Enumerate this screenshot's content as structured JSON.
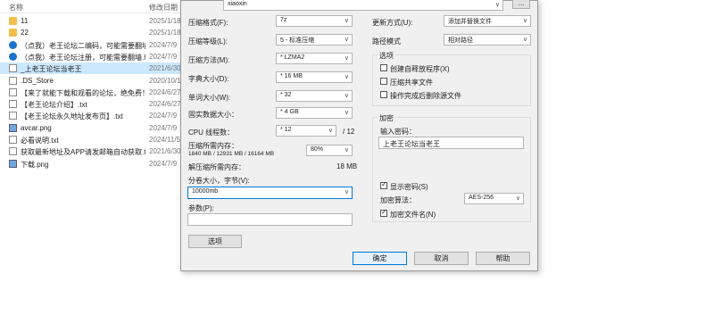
{
  "explorer": {
    "col_name": "名称",
    "col_date": "修改日期",
    "rows": [
      {
        "name": "11",
        "date": "2025/1/18",
        "icon": "folder-icon"
      },
      {
        "name": "22",
        "date": "2025/1/18",
        "icon": "folder-icon"
      },
      {
        "name": "（点我）老王论坛二编码，可能需要翻墙...",
        "date": "2024/7/9",
        "icon": "edge-icon"
      },
      {
        "name": "（点我）老王论坛注册，可能需要翻墙.h...",
        "date": "2024/7/9",
        "icon": "edge-icon"
      },
      {
        "name": "_上老王论坛当老王",
        "date": "2021/6/30",
        "icon": "file-icon"
      },
      {
        "name": ".DS_Store",
        "date": "2020/10/1",
        "icon": "file-icon"
      },
      {
        "name": "【来了就能下载和观看的论坛，绝免费！...",
        "date": "2024/6/27",
        "icon": "text-file-icon"
      },
      {
        "name": "【老王论坛介绍】.txt",
        "date": "2024/6/27",
        "icon": "text-file-icon"
      },
      {
        "name": "【老王论坛永久地址发布页】.txt",
        "date": "2024/7/9",
        "icon": "text-file-icon"
      },
      {
        "name": "avcar.png",
        "date": "2024/7/9",
        "icon": "image-icon"
      },
      {
        "name": "必看说明.txt",
        "date": "2024/11/5",
        "icon": "text-file-icon"
      },
      {
        "name": "获取最新地址及APP请发邮箱自动获取.txt",
        "date": "2021/6/30",
        "icon": "text-file-icon"
      },
      {
        "name": "下载.png",
        "date": "2024/7/9",
        "icon": "image-icon"
      }
    ],
    "selected_index": 4
  },
  "dialog": {
    "archive_name": "xiaoxin",
    "format_label": "压缩格式(F):",
    "format_value": "7z",
    "level_label": "压缩等级(L):",
    "level_value": "5 - 标准压缩",
    "method_label": "压缩方法(M):",
    "method_value": "* LZMA2",
    "dict_label": "字典大小(D):",
    "dict_value": "* 16 MB",
    "word_label": "单词大小(W):",
    "word_value": "* 32",
    "solid_label": "固实数据大小：",
    "solid_value": "* 4 GB",
    "cpu_label": "CPU 线程数：",
    "cpu_value": "* 12",
    "cpu_total": "/ 12",
    "mem_label": "压缩所需内存：",
    "mem_detail": "1840 MB / 12931 MB / 16164 MB",
    "mem_pct": "80%",
    "decomp_label": "解压缩所需内存：",
    "decomp_value": "18 MB",
    "split_label": "分卷大小，字节(V):",
    "split_value": "10000mb",
    "params_label": "参数(P):",
    "params_value": "",
    "options_button": "选项",
    "update_label": "更新方式(U):",
    "update_value": "添加并替换文件",
    "path_label": "路径模式",
    "path_value": "相对路径",
    "options_group": "选项",
    "opt_sfx": "创建自释放程序(X)",
    "opt_shared": "压缩共享文件",
    "opt_delete": "操作完成后删除源文件",
    "encrypt_group": "加密",
    "password_label": "输入密码：",
    "password_value": "上老王论坛当老王",
    "show_password": "显示密码(S)",
    "enc_method_label": "加密算法：",
    "enc_method_value": "AES-256",
    "encrypt_names": "加密文件名(N)",
    "ok": "确定",
    "cancel": "取消",
    "help": "帮助",
    "browse": "..."
  }
}
